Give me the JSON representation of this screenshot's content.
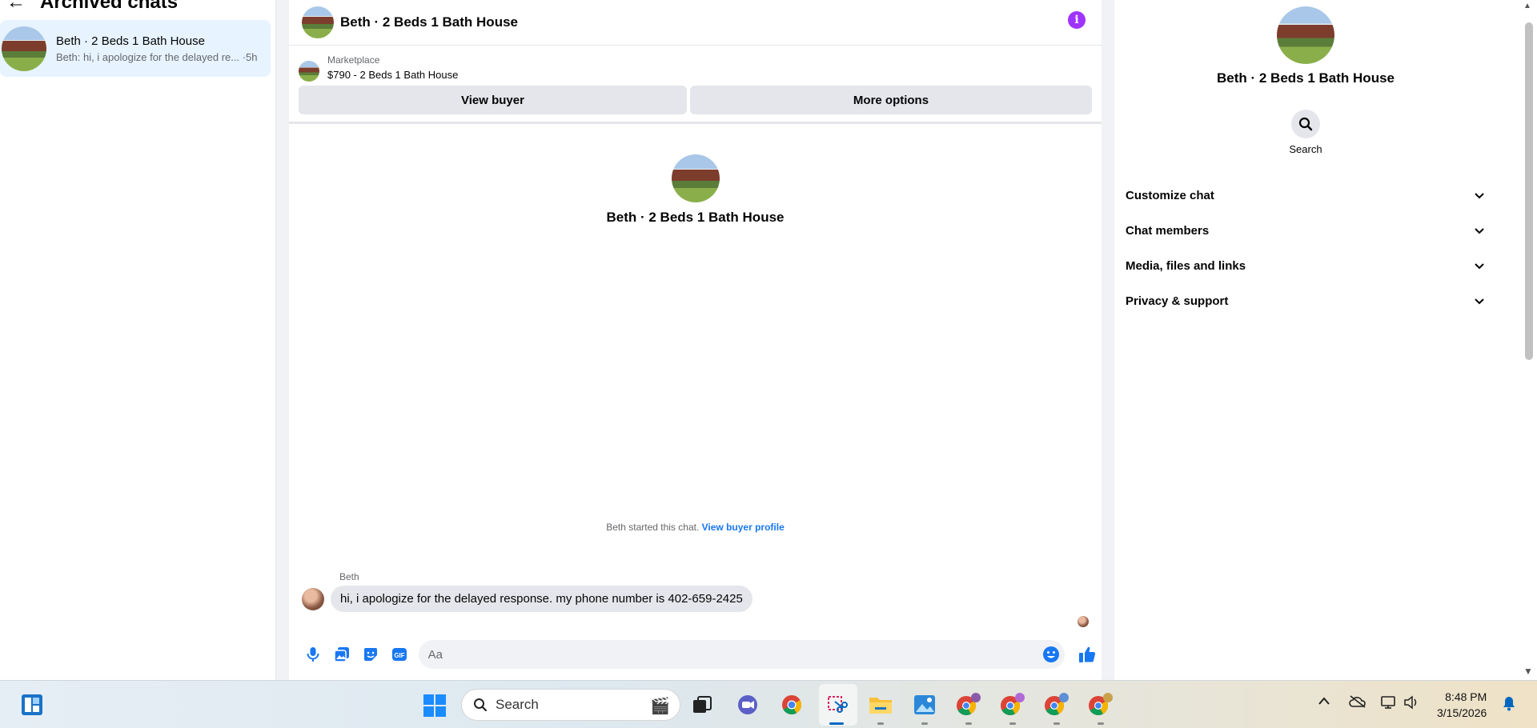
{
  "sidebar": {
    "back_icon": "←",
    "title": "Archived chats",
    "chat": {
      "name": "Beth · 2 Beds 1 Bath House",
      "preview": "Beth: hi, i apologize for the delayed re... ·5h"
    }
  },
  "conversation": {
    "title": "Beth · 2 Beds 1 Bath House",
    "info_icon": "i",
    "marketplace": {
      "label": "Marketplace",
      "item": "$790 - 2 Beds 1 Bath House",
      "view_buyer": "View buyer",
      "more_options": "More options"
    },
    "profile_name": "Beth · 2 Beds 1 Bath House",
    "started_text": "Beth started this chat.",
    "view_buyer_profile": "View buyer profile",
    "message": {
      "sender": "Beth",
      "text": "hi, i apologize for the delayed response. my phone number is 402-659-2425"
    },
    "composer": {
      "placeholder": "Aa"
    },
    "colors": {
      "accent": "#1877f2",
      "info": "#a033ff"
    }
  },
  "details_panel": {
    "name": "Beth · 2 Beds 1 Bath House",
    "search_label": "Search",
    "sections": [
      {
        "label": "Customize chat"
      },
      {
        "label": "Chat members"
      },
      {
        "label": "Media, files and links"
      },
      {
        "label": "Privacy & support"
      }
    ]
  },
  "taskbar": {
    "search_placeholder": "Search",
    "apps": [
      "task-view-icon",
      "teams-icon",
      "chrome-icon",
      "snipping-tool-icon",
      "file-explorer-icon",
      "photos-icon",
      "chrome-profile-1-icon",
      "chrome-profile-2-icon",
      "chrome-profile-3-icon",
      "chrome-profile-4-icon"
    ],
    "time": "8:48 PM",
    "date": "3/15/2026"
  }
}
